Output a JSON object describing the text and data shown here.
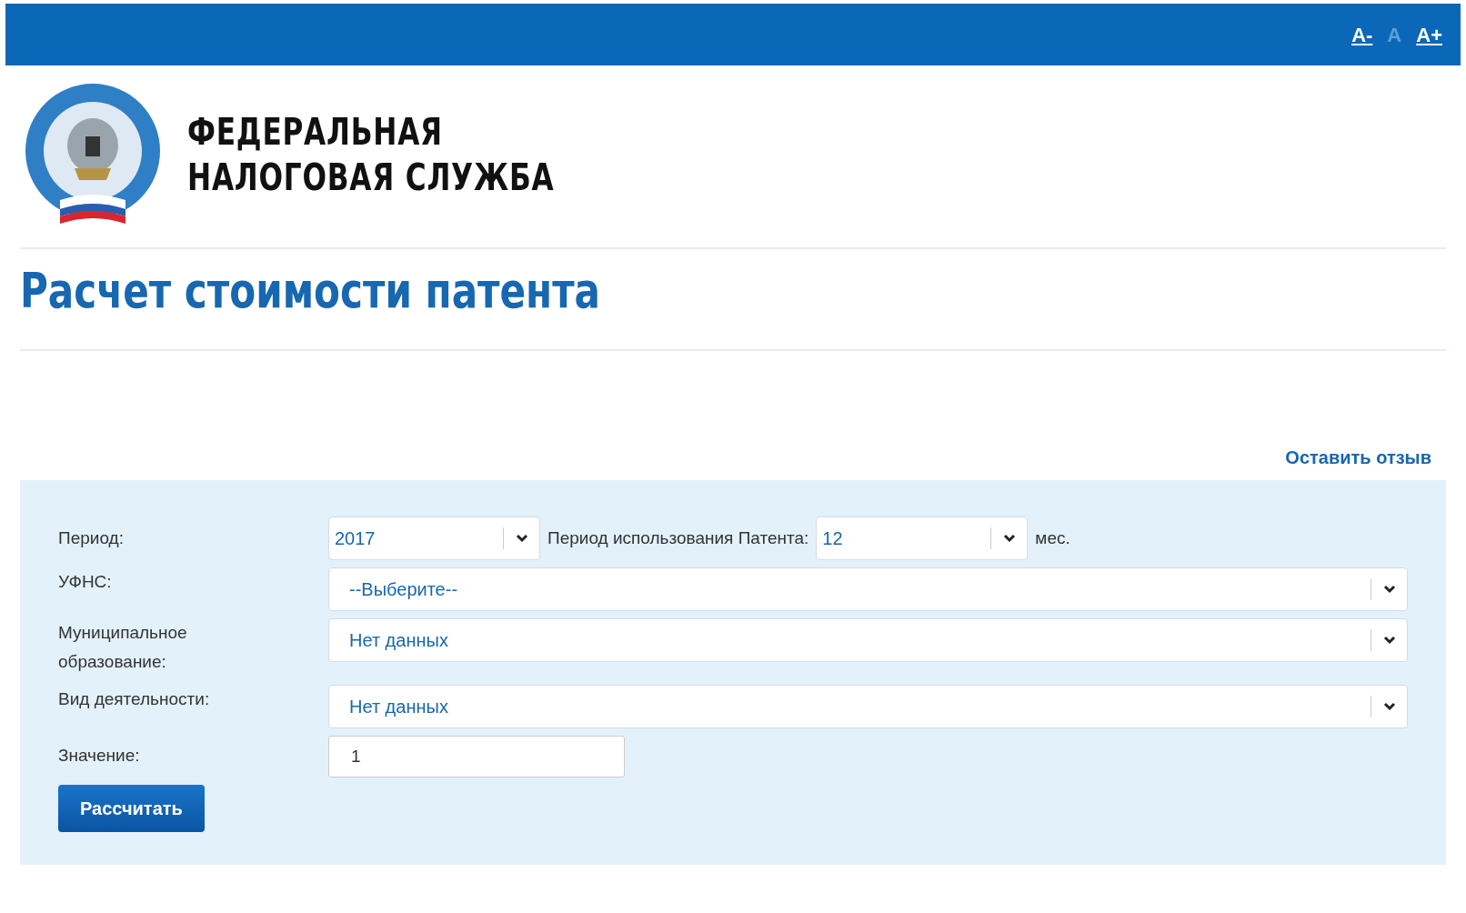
{
  "font_size_controls": [
    {
      "label": "A-",
      "selected": false
    },
    {
      "label": "A",
      "selected": true
    },
    {
      "label": "A+",
      "selected": false
    }
  ],
  "header": {
    "title_line_1": "ФЕДЕРАЛЬНАЯ",
    "title_line_2": "НАЛОГОВАЯ СЛУЖБА"
  },
  "page_title": "Расчет стоимости патента",
  "feedback_link": "Оставить отзыв",
  "form": {
    "period": {
      "label": "Период:",
      "value": "2017",
      "usage_label": "Период использования Патента:",
      "usage_value": "12",
      "unit": "мес."
    },
    "rows": [
      {
        "label": "УФНС:",
        "value": "--Выберите--"
      },
      {
        "label": "Муниципальное образование:",
        "value": "Нет данных"
      },
      {
        "label": "Вид деятельности:",
        "value": "Нет данных"
      }
    ],
    "value_field": {
      "label": "Значение:",
      "value": "1"
    },
    "submit": "Рассчитать"
  }
}
